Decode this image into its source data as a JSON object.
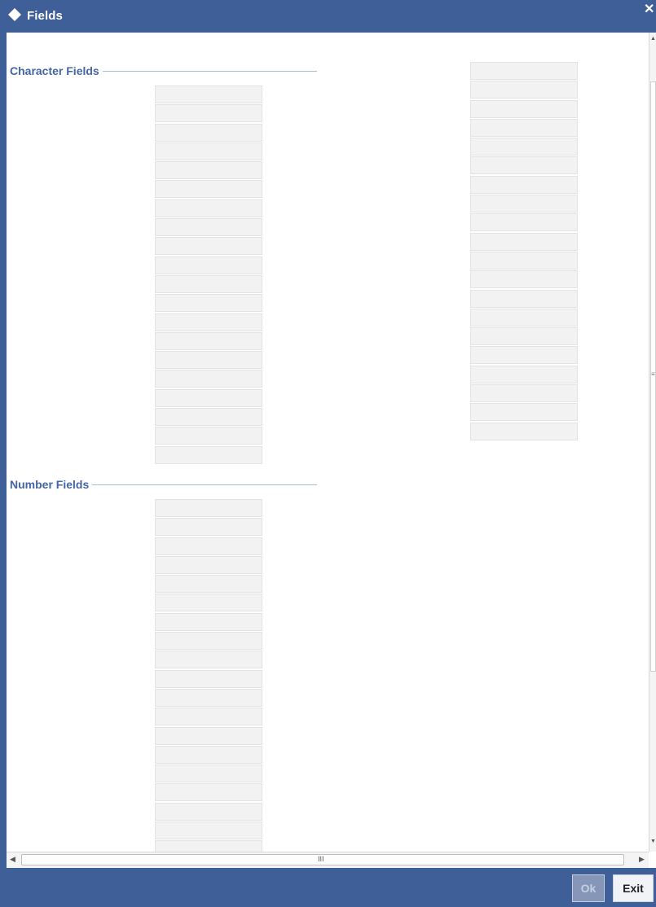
{
  "window": {
    "title": "Fields",
    "close_glyph": "✕"
  },
  "sections": {
    "character_fields": {
      "label": "Character Fields"
    },
    "number_fields": {
      "label": "Number Fields"
    }
  },
  "character_fields_column1": {
    "values": [
      "",
      "",
      "",
      "",
      "",
      "",
      "",
      "",
      "",
      "",
      "",
      "",
      "",
      "",
      "",
      "",
      "",
      "",
      "",
      ""
    ]
  },
  "character_fields_column2": {
    "values": [
      "",
      "",
      "",
      "",
      "",
      "",
      "",
      "",
      "",
      "",
      "",
      "",
      "",
      "",
      "",
      "",
      "",
      "",
      "",
      ""
    ]
  },
  "number_fields_column": {
    "values": [
      "",
      "",
      "",
      "",
      "",
      "",
      "",
      "",
      "",
      "",
      "",
      "",
      "",
      "",
      "",
      "",
      "",
      "",
      "",
      ""
    ]
  },
  "scrollbar": {
    "grip": "III"
  },
  "footer": {
    "ok_label": "Ok",
    "exit_label": "Exit"
  },
  "icons": {
    "title_icon": "diamond-icon",
    "close_icon": "close-icon"
  },
  "colors": {
    "titlebar": "#3f5f98",
    "section_label": "#4466a8",
    "field_bg": "#f2f2f2"
  }
}
